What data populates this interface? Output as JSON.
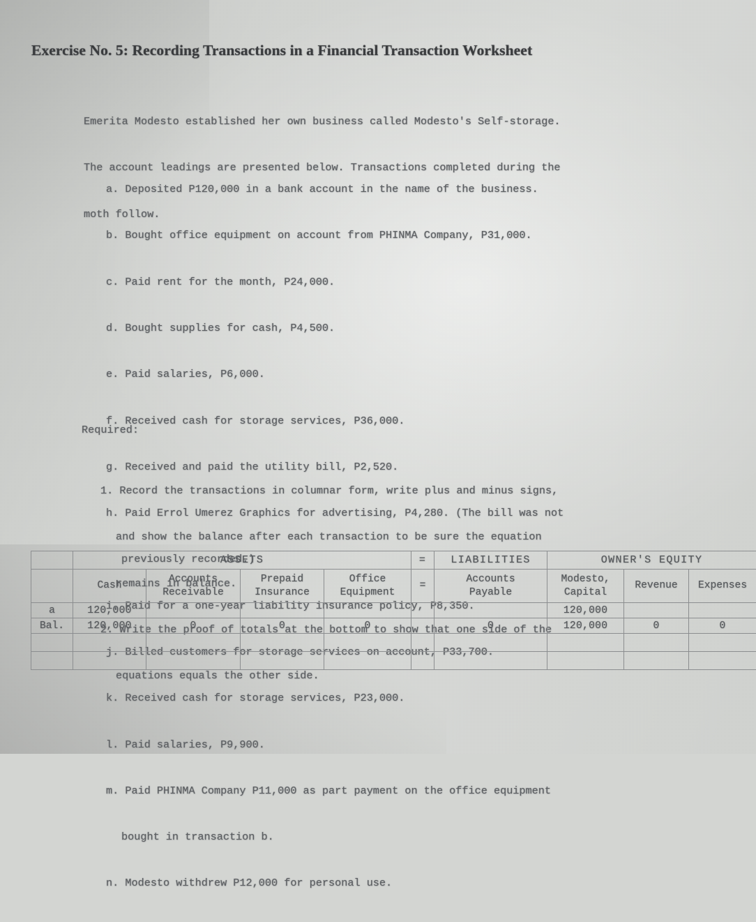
{
  "document": {
    "title": "Exercise No. 5: Recording Transactions in a Financial Transaction Worksheet",
    "intro": [
      "Emerita Modesto established her own business called Modesto's Self-storage.",
      "The account leadings are presented below. Transactions completed during the",
      "moth follow."
    ],
    "transactions": [
      {
        "label": "a.",
        "text": "Deposited P120,000 in a bank account in the name of the business."
      },
      {
        "label": "b.",
        "text": "Bought office equipment on account from PHINMA Company, P31,000."
      },
      {
        "label": "c.",
        "text": "Paid rent for the month, P24,000."
      },
      {
        "label": "d.",
        "text": "Bought supplies for cash, P4,500."
      },
      {
        "label": "e.",
        "text": "Paid salaries, P6,000."
      },
      {
        "label": "f.",
        "text": "Received cash for storage services, P36,000."
      },
      {
        "label": "g.",
        "text": "Received and paid the utility bill, P2,520."
      },
      {
        "label": "h.",
        "text": "Paid Errol Umerez Graphics for advertising, P4,280. (The bill was not",
        "cont": "previously recorded.)"
      },
      {
        "label": "i.",
        "text": "Paid for a one-year liability insurance policy, P8,350."
      },
      {
        "label": "j.",
        "text": "Billed customers for storage services on account, P33,700."
      },
      {
        "label": "k.",
        "text": "Received cash for storage services, P23,000."
      },
      {
        "label": "l.",
        "text": "Paid salaries, P9,900."
      },
      {
        "label": "m.",
        "text": "Paid PHINMA Company P11,000 as part payment on the office equipment",
        "cont": "bought in transaction b."
      },
      {
        "label": "n.",
        "text": "Modesto withdrew P12,000 for personal use."
      }
    ],
    "required_heading": "Required:",
    "required": [
      {
        "label": "1.",
        "lines": [
          "Record the transactions in columnar form, write plus and minus signs,",
          "and show the balance after each transaction to be sure the equation",
          "remains in balance."
        ]
      },
      {
        "label": "2.",
        "lines": [
          "Write the proof of totals at the bottom to show that one side of the",
          "equations equals the other side."
        ]
      }
    ]
  },
  "worksheet": {
    "group_headers": {
      "assets": "ASSETS",
      "equals_top": "=",
      "liabilities": "LIABILITIES",
      "owners_equity": "OWNER'S EQUITY"
    },
    "column_headers": {
      "row_label": "",
      "cash": "Cash",
      "accounts_receivable_line1": "Accounts",
      "accounts_receivable_line2": "Receivable",
      "prepaid_insurance_line1": "Prepaid",
      "prepaid_insurance_line2": "Insurance",
      "office_equipment_line1": "Office",
      "office_equipment_line2": "Equipment",
      "equals": "=",
      "accounts_payable_line1": "Accounts",
      "accounts_payable_line2": "Payable",
      "modesto_capital_line1": "Modesto,",
      "modesto_capital_line2": "Capital",
      "revenue": "Revenue",
      "expenses": "Expenses"
    },
    "rows": [
      {
        "label": "a",
        "cash": "120,000",
        "accounts_receivable": "",
        "prepaid_insurance": "",
        "office_equipment": "",
        "equals": "",
        "accounts_payable": "",
        "modesto_capital": "120,000",
        "revenue": "",
        "expenses": ""
      },
      {
        "label": "Bal.",
        "cash": "120,000",
        "accounts_receivable": "0",
        "prepaid_insurance": "0",
        "office_equipment": "0",
        "equals": "",
        "accounts_payable": "0",
        "modesto_capital": "120,000",
        "revenue": "0",
        "expenses": "0"
      },
      {
        "label": "",
        "cash": "",
        "accounts_receivable": "",
        "prepaid_insurance": "",
        "office_equipment": "",
        "equals": "",
        "accounts_payable": "",
        "modesto_capital": "",
        "revenue": "",
        "expenses": ""
      },
      {
        "label": "",
        "cash": "",
        "accounts_receivable": "",
        "prepaid_insurance": "",
        "office_equipment": "",
        "equals": "",
        "accounts_payable": "",
        "modesto_capital": "",
        "revenue": "",
        "expenses": ""
      }
    ]
  }
}
